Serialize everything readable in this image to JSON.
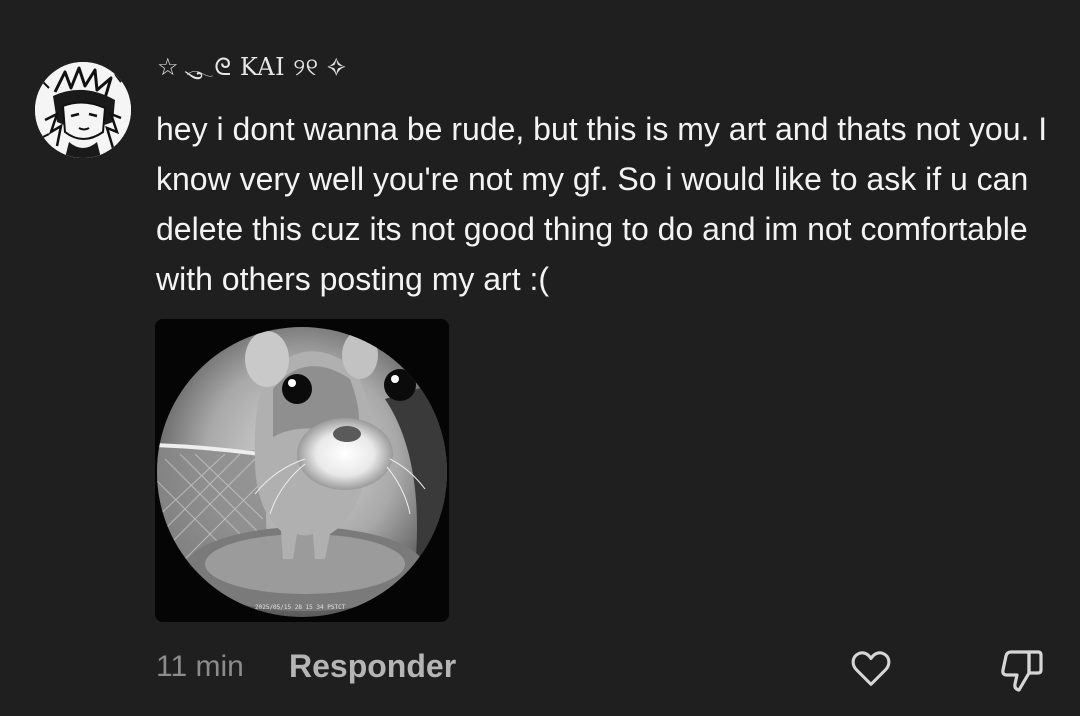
{
  "comment": {
    "username": "☆ ུ𓂃ᘓ KAI ୨୧ ✧",
    "text": "hey i dont wanna be rude, but this is my art and thats not you. I know very well you're not my gf. So i would like to ask if u can delete this cuz its not good thing to do and im not comfortable with others posting my art :(",
    "image_timestamp": "2025/05/15 28 15 34 PSTCT"
  },
  "footer": {
    "time": "11 min",
    "reply_label": "Responder"
  },
  "icons": {
    "avatar": "avatar-drawing",
    "like": "heart-icon",
    "dislike": "thumbs-down-icon"
  },
  "colors": {
    "background": "#1f1f1f",
    "text": "#f3f3f3",
    "muted": "#8c8c8c",
    "reply": "#b5b5b5"
  }
}
